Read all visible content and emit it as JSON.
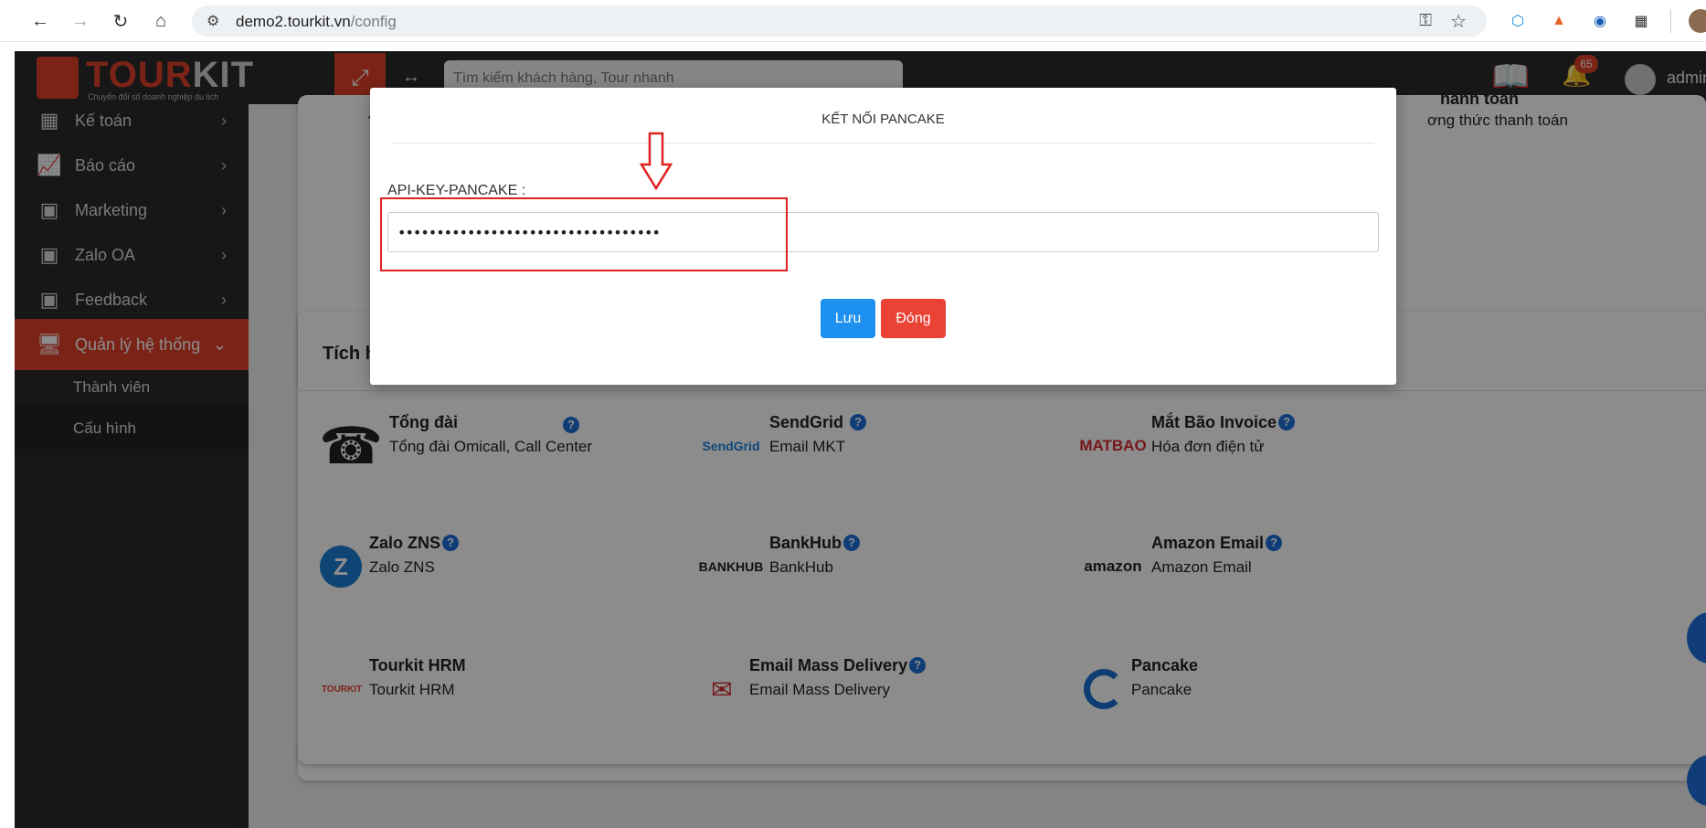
{
  "browser": {
    "url_host": "demo2.tourkit.vn",
    "url_path": "/config"
  },
  "app": {
    "logo_main": "TOUR",
    "logo_accent": "KIT",
    "logo_tagline": "Chuyển đổi số doanh nghiệp du lịch",
    "search_placeholder": "Tìm kiếm khách hàng, Tour nhanh",
    "notification_count": "65",
    "user_name": "admin"
  },
  "sidebar": {
    "items": [
      {
        "label": "Kế toán",
        "icon": "calculator-icon"
      },
      {
        "label": "Báo cáo",
        "icon": "chart-icon"
      },
      {
        "label": "Marketing",
        "icon": "presentation-icon"
      },
      {
        "label": "Zalo OA",
        "icon": "presentation-icon"
      },
      {
        "label": "Feedback",
        "icon": "presentation-icon"
      },
      {
        "label": "Quản lý hệ thống",
        "icon": "monitor-icon",
        "active": true
      }
    ],
    "sub_items": [
      {
        "label": "Thành viên"
      },
      {
        "label": "Cấu hình",
        "active": true
      }
    ]
  },
  "content": {
    "payment": {
      "title_partial": "hanh toán",
      "desc_partial": "ơng thức thanh toán"
    },
    "integrations_title_partial": "Tích h",
    "integrations": [
      {
        "name": "Tổng đài",
        "desc": "Tổng đài Omicall, Call Center",
        "logo": "telephone-icon"
      },
      {
        "name": "SendGrid",
        "desc": "Email MKT",
        "logo": "sendgrid-logo",
        "logo_text": "SendGrid"
      },
      {
        "name": "Mắt Bão Invoice",
        "desc": "Hóa đơn điện tử",
        "logo": "matbao-logo",
        "logo_text": "MATBAO"
      },
      {
        "name": "Zalo ZNS",
        "desc": "Zalo ZNS",
        "logo": "zalo-icon"
      },
      {
        "name": "BankHub",
        "desc": "BankHub",
        "logo": "bankhub-logo",
        "logo_text": "BANKHUB"
      },
      {
        "name": "Amazon Email",
        "desc": "Amazon Email",
        "logo": "amazon-logo",
        "logo_text": "amazon"
      },
      {
        "name": "Tourkit HRM",
        "desc": "Tourkit HRM",
        "logo": "tourkit-logo",
        "logo_text": "TOURKIT"
      },
      {
        "name": "Email Mass Delivery",
        "desc": "Email Mass Delivery",
        "logo": "email-mass-logo"
      },
      {
        "name": "Pancake",
        "desc": "Pancake",
        "logo": "pancake-logo"
      }
    ]
  },
  "modal": {
    "title": "KẾT NỐI PANCAKE",
    "label": "API-KEY-PANCAKE :",
    "value": "••••••••••••••••••••••••••••••••••",
    "save": "Lưu",
    "close": "Đóng"
  },
  "colors": {
    "brand": "#e0412a",
    "primary": "#1e90ef",
    "danger": "#ea4335",
    "annotation": "#e02020"
  }
}
